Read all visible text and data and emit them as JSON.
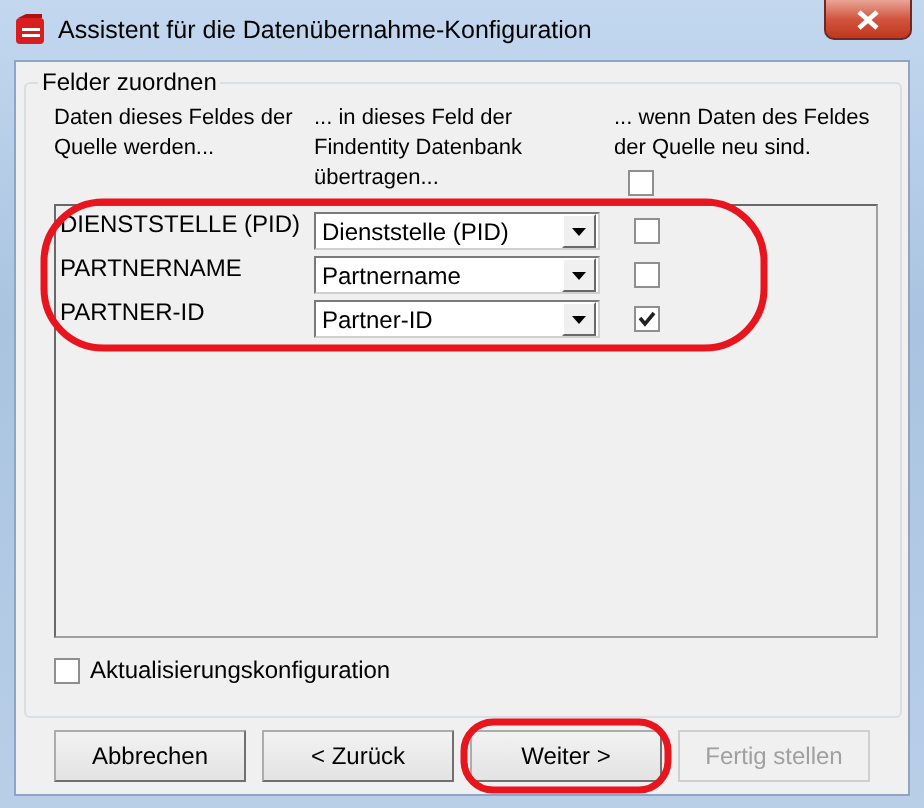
{
  "window": {
    "title": "Assistent für die Datenübernahme-Konfiguration"
  },
  "group": {
    "title": "Felder zuordnen",
    "headers": [
      "Daten dieses Feldes der\nQuelle werden...",
      "... in dieses Feld der\nFindentity Datenbank\nübertragen...",
      "... wenn Daten des Feldes\nder Quelle neu sind."
    ],
    "header_checkbox": {
      "checked": false
    }
  },
  "mappings_highlighted": true,
  "mappings": [
    {
      "source": "DIENSTSTELLE (PID)",
      "target": "Dienststelle (PID)",
      "checked": false
    },
    {
      "source": "PARTNERNAME",
      "target": "Partnername",
      "checked": false
    },
    {
      "source": "PARTNER-ID",
      "target": "Partner-ID",
      "checked": true
    }
  ],
  "update_config": {
    "label": "Aktualisierungskonfiguration",
    "checked": false
  },
  "buttons": [
    {
      "label": "Abbrechen",
      "disabled": false,
      "highlighted": false
    },
    {
      "label": "< Zurück",
      "disabled": false,
      "highlighted": false
    },
    {
      "label": "Weiter >",
      "disabled": false,
      "highlighted": true
    },
    {
      "label": "Fertig stellen",
      "disabled": true,
      "highlighted": false
    }
  ]
}
